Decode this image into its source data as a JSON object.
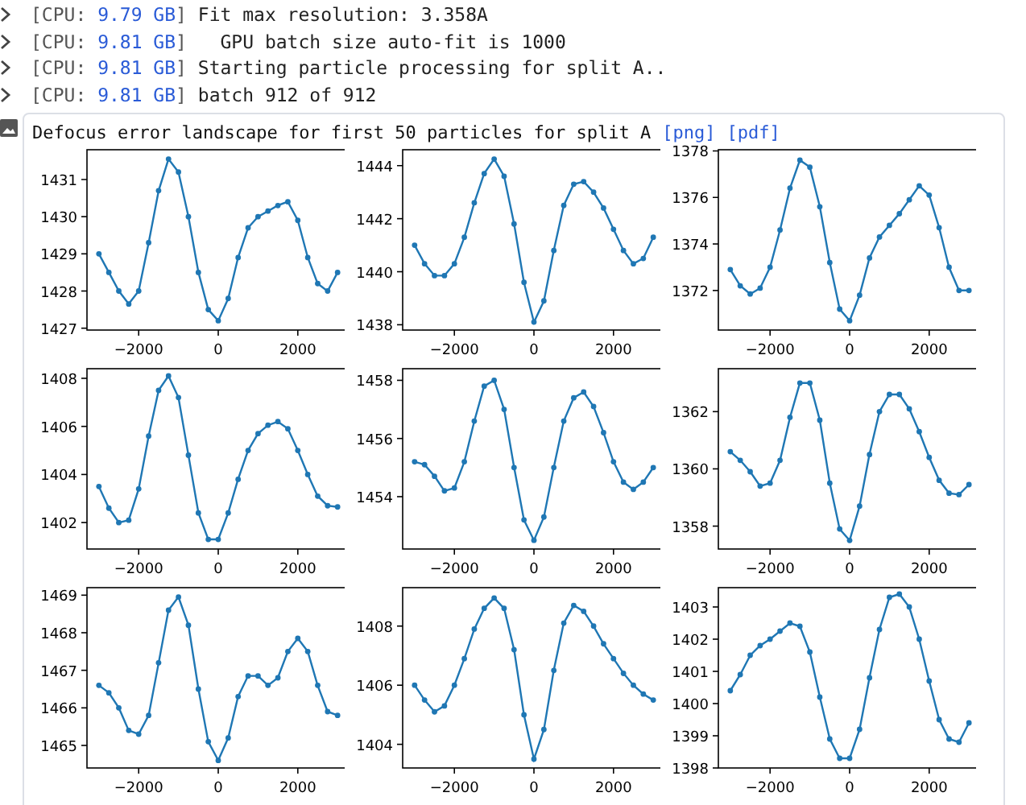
{
  "log_lines": [
    {
      "label": "[CPU:",
      "memory": "9.79 GB",
      "close": "]",
      "message": "Fit max resolution: 3.358A"
    },
    {
      "label": "[CPU:",
      "memory": "9.81 GB",
      "close": "]",
      "message": "  GPU batch size auto-fit is 1000"
    },
    {
      "label": "[CPU:",
      "memory": "9.81 GB",
      "close": "]",
      "message": "Starting particle processing for split A.."
    },
    {
      "label": "[CPU:",
      "memory": "9.81 GB",
      "close": "]",
      "message": "batch 912 of 912"
    }
  ],
  "output": {
    "title": "Defocus error landscape for first 50 particles for split A",
    "links": [
      "[png]",
      "[pdf]"
    ],
    "charts": [
      {
        "chart_data": {
          "type": "line",
          "x": [
            -3000,
            -2750,
            -2500,
            -2250,
            -2000,
            -1750,
            -1500,
            -1250,
            -1000,
            -750,
            -500,
            -250,
            0,
            250,
            500,
            750,
            1000,
            1250,
            1500,
            1750,
            2000,
            2250,
            2500,
            2750,
            3000
          ],
          "series": [
            {
              "marker": "o",
              "color": "#1f77b4",
              "values": [
                1429.0,
                1428.5,
                1428.0,
                1427.65,
                1428.0,
                1429.3,
                1430.7,
                1431.55,
                1431.2,
                1430.0,
                1428.5,
                1427.5,
                1427.2,
                1427.8,
                1428.9,
                1429.7,
                1430.0,
                1430.15,
                1430.3,
                1430.4,
                1429.9,
                1428.9,
                1428.2,
                1428.0,
                1428.5
              ]
            }
          ],
          "xlim": [
            -3300,
            3300
          ],
          "ylim": [
            1426.95,
            1431.8
          ],
          "xticks": [
            -2000,
            0,
            2000
          ],
          "yticks": [
            1427,
            1428,
            1429,
            1430,
            1431
          ]
        }
      },
      {
        "chart_data": {
          "type": "line",
          "x": [
            -3000,
            -2750,
            -2500,
            -2250,
            -2000,
            -1750,
            -1500,
            -1250,
            -1000,
            -750,
            -500,
            -250,
            0,
            250,
            500,
            750,
            1000,
            1250,
            1500,
            1750,
            2000,
            2250,
            2500,
            2750,
            3000
          ],
          "series": [
            {
              "marker": "o",
              "color": "#1f77b4",
              "values": [
                1441.0,
                1440.3,
                1439.85,
                1439.85,
                1440.3,
                1441.3,
                1442.6,
                1443.7,
                1444.25,
                1443.6,
                1441.8,
                1439.6,
                1438.1,
                1438.9,
                1440.8,
                1442.5,
                1443.3,
                1443.4,
                1443.0,
                1442.4,
                1441.6,
                1440.8,
                1440.3,
                1440.5,
                1441.3
              ]
            }
          ],
          "xlim": [
            -3300,
            3300
          ],
          "ylim": [
            1437.8,
            1444.6
          ],
          "xticks": [
            -2000,
            0,
            2000
          ],
          "yticks": [
            1438,
            1440,
            1442,
            1444
          ]
        }
      },
      {
        "chart_data": {
          "type": "line",
          "x": [
            -3000,
            -2750,
            -2500,
            -2250,
            -2000,
            -1750,
            -1500,
            -1250,
            -1000,
            -750,
            -500,
            -250,
            0,
            250,
            500,
            750,
            1000,
            1250,
            1500,
            1750,
            2000,
            2250,
            2500,
            2750,
            3000
          ],
          "series": [
            {
              "marker": "o",
              "color": "#1f77b4",
              "values": [
                1372.9,
                1372.2,
                1371.85,
                1372.1,
                1373.0,
                1374.6,
                1376.4,
                1377.6,
                1377.3,
                1375.6,
                1373.2,
                1371.2,
                1370.7,
                1371.8,
                1373.4,
                1374.3,
                1374.8,
                1375.3,
                1375.9,
                1376.5,
                1376.1,
                1374.7,
                1373.0,
                1372.0,
                1372.0
              ]
            }
          ],
          "xlim": [
            -3300,
            3300
          ],
          "ylim": [
            1370.3,
            1378.05
          ],
          "xticks": [
            -2000,
            0,
            2000
          ],
          "yticks": [
            1372,
            1374,
            1376,
            1378
          ]
        }
      },
      {
        "chart_data": {
          "type": "line",
          "x": [
            -3000,
            -2750,
            -2500,
            -2250,
            -2000,
            -1750,
            -1500,
            -1250,
            -1000,
            -750,
            -500,
            -250,
            0,
            250,
            500,
            750,
            1000,
            1250,
            1500,
            1750,
            2000,
            2250,
            2500,
            2750,
            3000
          ],
          "series": [
            {
              "marker": "o",
              "color": "#1f77b4",
              "values": [
                1403.5,
                1402.6,
                1402.0,
                1402.1,
                1403.4,
                1405.6,
                1407.5,
                1408.1,
                1407.2,
                1404.8,
                1402.4,
                1401.3,
                1401.3,
                1402.4,
                1403.8,
                1405.0,
                1405.7,
                1406.05,
                1406.2,
                1405.9,
                1405.0,
                1404.0,
                1403.1,
                1402.7,
                1402.65
              ]
            }
          ],
          "xlim": [
            -3300,
            3300
          ],
          "ylim": [
            1400.9,
            1408.4
          ],
          "xticks": [
            -2000,
            0,
            2000
          ],
          "yticks": [
            1402,
            1404,
            1406,
            1408
          ]
        }
      },
      {
        "chart_data": {
          "type": "line",
          "x": [
            -3000,
            -2750,
            -2500,
            -2250,
            -2000,
            -1750,
            -1500,
            -1250,
            -1000,
            -750,
            -500,
            -250,
            0,
            250,
            500,
            750,
            1000,
            1250,
            1500,
            1750,
            2000,
            2250,
            2500,
            2750,
            3000
          ],
          "series": [
            {
              "marker": "o",
              "color": "#1f77b4",
              "values": [
                1455.2,
                1455.1,
                1454.7,
                1454.2,
                1454.3,
                1455.2,
                1456.6,
                1457.8,
                1458.0,
                1457.0,
                1455.0,
                1453.2,
                1452.5,
                1453.3,
                1455.0,
                1456.6,
                1457.4,
                1457.6,
                1457.1,
                1456.2,
                1455.2,
                1454.5,
                1454.25,
                1454.5,
                1455.0
              ]
            }
          ],
          "xlim": [
            -3300,
            3300
          ],
          "ylim": [
            1452.2,
            1458.4
          ],
          "xticks": [
            -2000,
            0,
            2000
          ],
          "yticks": [
            1454,
            1456,
            1458
          ]
        }
      },
      {
        "chart_data": {
          "type": "line",
          "x": [
            -3000,
            -2750,
            -2500,
            -2250,
            -2000,
            -1750,
            -1500,
            -1250,
            -1000,
            -750,
            -500,
            -250,
            0,
            250,
            500,
            750,
            1000,
            1250,
            1500,
            1750,
            2000,
            2250,
            2500,
            2750,
            3000
          ],
          "series": [
            {
              "marker": "o",
              "color": "#1f77b4",
              "values": [
                1360.6,
                1360.3,
                1359.9,
                1359.4,
                1359.5,
                1360.3,
                1361.8,
                1363.0,
                1363.0,
                1361.7,
                1359.5,
                1357.9,
                1357.5,
                1358.7,
                1360.5,
                1362.0,
                1362.6,
                1362.6,
                1362.1,
                1361.3,
                1360.4,
                1359.6,
                1359.15,
                1359.1,
                1359.45
              ]
            }
          ],
          "xlim": [
            -3300,
            3300
          ],
          "ylim": [
            1357.2,
            1363.5
          ],
          "xticks": [
            -2000,
            0,
            2000
          ],
          "yticks": [
            1358,
            1360,
            1362
          ]
        }
      },
      {
        "chart_data": {
          "type": "line",
          "x": [
            -3000,
            -2750,
            -2500,
            -2250,
            -2000,
            -1750,
            -1500,
            -1250,
            -1000,
            -750,
            -500,
            -250,
            0,
            250,
            500,
            750,
            1000,
            1250,
            1500,
            1750,
            2000,
            2250,
            2500,
            2750,
            3000
          ],
          "series": [
            {
              "marker": "o",
              "color": "#1f77b4",
              "values": [
                1466.6,
                1466.4,
                1466.0,
                1465.4,
                1465.3,
                1465.8,
                1467.2,
                1468.6,
                1468.95,
                1468.2,
                1466.5,
                1465.1,
                1464.6,
                1465.2,
                1466.3,
                1466.85,
                1466.85,
                1466.6,
                1466.8,
                1467.5,
                1467.85,
                1467.5,
                1466.6,
                1465.9,
                1465.8
              ]
            }
          ],
          "xlim": [
            -3300,
            3300
          ],
          "ylim": [
            1464.4,
            1469.2
          ],
          "xticks": [
            -2000,
            0,
            2000
          ],
          "yticks": [
            1465,
            1466,
            1467,
            1468,
            1469
          ]
        }
      },
      {
        "chart_data": {
          "type": "line",
          "x": [
            -3000,
            -2750,
            -2500,
            -2250,
            -2000,
            -1750,
            -1500,
            -1250,
            -1000,
            -750,
            -500,
            -250,
            0,
            250,
            500,
            750,
            1000,
            1250,
            1500,
            1750,
            2000,
            2250,
            2500,
            2750,
            3000
          ],
          "series": [
            {
              "marker": "o",
              "color": "#1f77b4",
              "values": [
                1406.0,
                1405.5,
                1405.1,
                1405.3,
                1406.0,
                1406.9,
                1407.9,
                1408.6,
                1408.95,
                1408.6,
                1407.2,
                1405.0,
                1403.5,
                1404.5,
                1406.5,
                1408.1,
                1408.7,
                1408.5,
                1408.0,
                1407.4,
                1406.9,
                1406.4,
                1406.0,
                1405.7,
                1405.5
              ]
            }
          ],
          "xlim": [
            -3300,
            3300
          ],
          "ylim": [
            1403.2,
            1409.3
          ],
          "xticks": [
            -2000,
            0,
            2000
          ],
          "yticks": [
            1404,
            1406,
            1408
          ]
        }
      },
      {
        "chart_data": {
          "type": "line",
          "x": [
            -3000,
            -2750,
            -2500,
            -2250,
            -2000,
            -1750,
            -1500,
            -1250,
            -1000,
            -750,
            -500,
            -250,
            0,
            250,
            500,
            750,
            1000,
            1250,
            1500,
            1750,
            2000,
            2250,
            2500,
            2750,
            3000
          ],
          "series": [
            {
              "marker": "o",
              "color": "#1f77b4",
              "values": [
                1400.4,
                1400.9,
                1401.5,
                1401.8,
                1402.0,
                1402.25,
                1402.5,
                1402.4,
                1401.6,
                1400.2,
                1398.9,
                1398.3,
                1398.3,
                1399.2,
                1400.8,
                1402.3,
                1403.3,
                1403.4,
                1403.0,
                1402.0,
                1400.7,
                1399.5,
                1398.9,
                1398.8,
                1399.4
              ]
            }
          ],
          "xlim": [
            -3300,
            3300
          ],
          "ylim": [
            1398.0,
            1403.6
          ],
          "xticks": [
            -2000,
            0,
            2000
          ],
          "yticks": [
            1398,
            1399,
            1400,
            1401,
            1402,
            1403
          ]
        }
      }
    ]
  }
}
